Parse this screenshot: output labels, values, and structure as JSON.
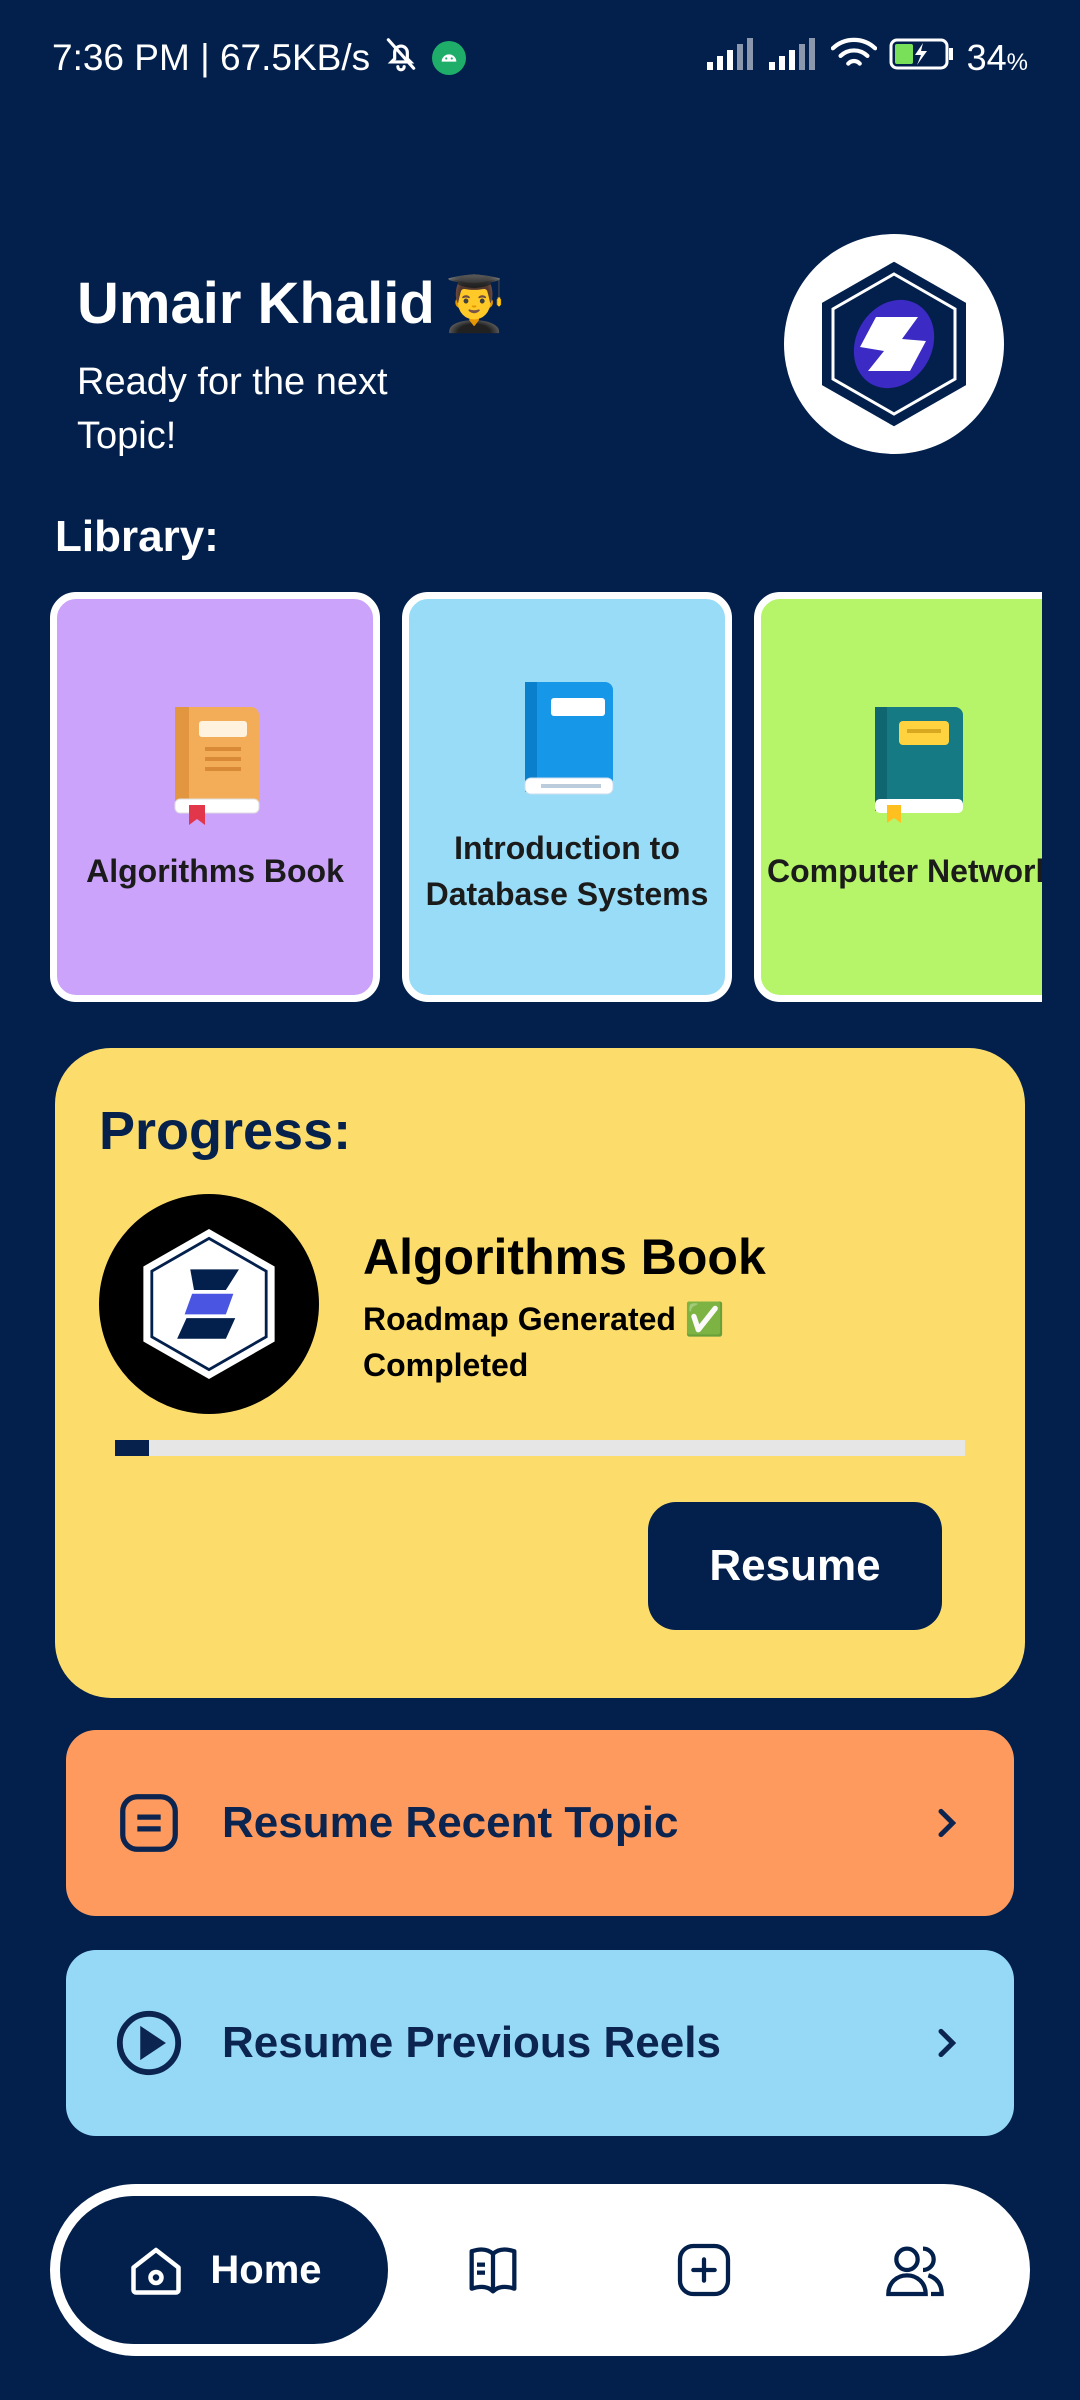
{
  "status_bar": {
    "time_speed": "7:36 PM | 67.5KB/s",
    "battery": "34",
    "battery_unit": "%"
  },
  "header": {
    "user_name": "Umair Khalid",
    "emoji": "👨‍🎓",
    "subtitle": "Ready for the next Topic!"
  },
  "library": {
    "label": "Library:",
    "books": [
      {
        "title": "Algorithms Book",
        "card_color": "#cca3fb",
        "icon": "orange-book-icon"
      },
      {
        "title": "Introduction to Database Systems",
        "card_color": "#98dcf8",
        "icon": "blue-book-icon"
      },
      {
        "title": "Computer Networks",
        "card_color": "#b6f46a",
        "icon": "teal-book-icon"
      }
    ]
  },
  "progress": {
    "label": "Progress:",
    "book_title": "Algorithms Book",
    "status_line1": "Roadmap Generated ✅",
    "status_line2": "Completed",
    "progress_fraction": 0.04,
    "resume_label": "Resume"
  },
  "actions": {
    "resume_topic": "Resume Recent Topic",
    "resume_reels": "Resume Previous Reels"
  },
  "nav": {
    "home_label": "Home",
    "items": [
      "home-icon",
      "book-open-icon",
      "add-square-icon",
      "users-icon"
    ]
  },
  "colors": {
    "background": "#03204c",
    "progress_card": "#fcdd6c",
    "topic_row": "#ff9a5e",
    "reels_row": "#96d9f7"
  }
}
